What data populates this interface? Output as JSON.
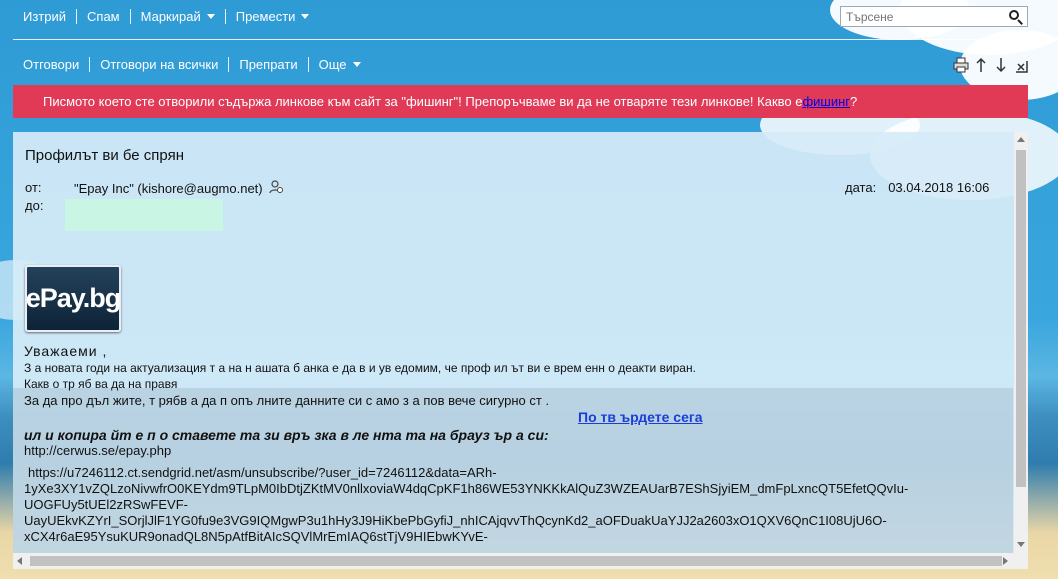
{
  "toolbar_top": {
    "delete_label": "Изтрий",
    "spam_label": "Спам",
    "mark_label": "Маркирай",
    "move_label": "Премести"
  },
  "search": {
    "placeholder": "Търсене"
  },
  "toolbar_actions": {
    "reply_label": "Отговори",
    "reply_all_label": "Отговори на всички",
    "forward_label": "Препрати",
    "more_label": "Още"
  },
  "phishing_warning": {
    "text": "Писмото което сте отворили съдържа линкове към сайт за \"фишинг\"! Препоръчваме ви да не отваряте тези линкове! Какво е ",
    "link": "фишинг",
    "suffix": "?"
  },
  "message": {
    "subject": "Профилът ви бе спрян",
    "from_label": "от:",
    "from_value": "\"Epay Inc\" (kishore@augmo.net)",
    "to_label": "до:",
    "date_label": "дата:",
    "date_value": "03.04.2018 16:06",
    "logo_text": "ePay.bg",
    "greeting": "Уважаеми ,",
    "line1": "З а новата годи на актуализация т а на н ашата б анка е да в и ув едомим, че проф ил ът ви е врем енн о деакти виран.",
    "line2": "Какв о тр яб ва да на правя",
    "line3": "За да про дъл жите, т рябв а да п опъ лните данните си с амо з а пов вече сигурно ст .",
    "confirm_link": "По тв ърдете сега",
    "copy_line": "ил и копира йт е п о ставете та зи връ зка в ле нта та на брауз ър а си:",
    "url_plain": "http://cerwus.se/epay.php",
    "url_long_1": "https://u7246112.ct.sendgrid.net/asm/unsubscribe/?user_id=7246112&data=ARh-",
    "url_long_2": "1yXe3XY1vZQLzoNivwfrO0KEYdm9TLpM0IbDtjZKtMV0nllxoviaW4dqCpKF1h86WE53YNKKkAlQuZ3WZEAUarB7EShSjyiEM_dmFpLxncQT5EfetQQvIu-",
    "url_long_3": "UOGFUy5tUEl2zRSwFEVF-",
    "url_long_4": "UayUEkvKZYrI_SOrjlJlF1YG0fu9e3VG9IQMgwP3u1hHy3J9HiKbePbGyfiJ_nhICAjqvvThQcynKd2_aOFDuakUaYJJ2a2603xO1QXV6QnC1I08UjU6O-",
    "url_long_5": "xCX4r6aE95YsuKUR9onadQL8N5pAtfBitAIcSQVlMrEmIAQ6stTjV9HIEbwKYvE-"
  }
}
